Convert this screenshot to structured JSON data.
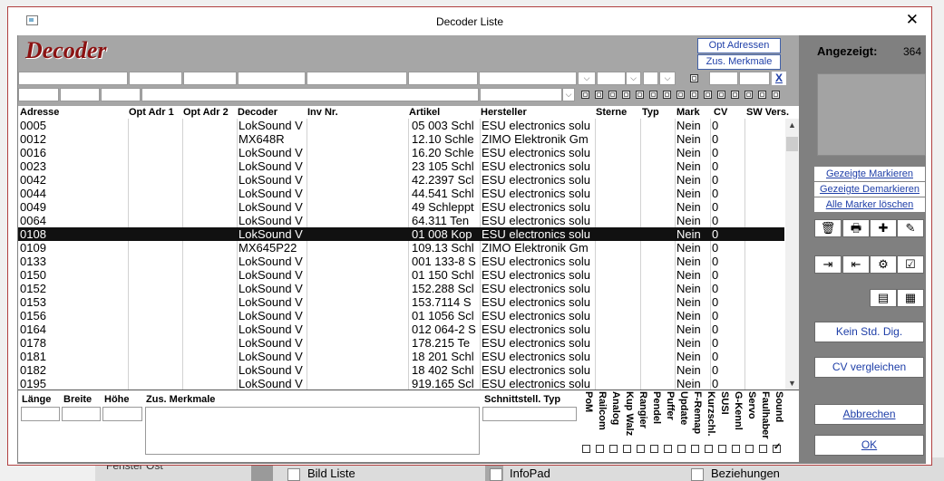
{
  "window": {
    "title": "Decoder Liste",
    "close": "✕"
  },
  "logo": "Decoder",
  "header_buttons": {
    "opt_adressen": "Opt Adressen",
    "zus_merkmale": "Zus. Merkmale"
  },
  "filter_clear": "X",
  "columns": [
    "Adresse",
    "Opt Adr 1",
    "Opt Adr 2",
    "Decoder",
    "Inv Nr.",
    "Artikel",
    "Hersteller",
    "Sterne",
    "Typ",
    "Mark",
    "CV",
    "SW Vers."
  ],
  "rows": [
    {
      "adresse": "0005",
      "decoder": "LokSound V",
      "artikel": "05 003 Schl",
      "hersteller": "ESU electronics solu",
      "mark": "Nein",
      "cv": "0"
    },
    {
      "adresse": "0012",
      "decoder": "MX648R",
      "artikel": "12.10 Schle",
      "hersteller": "ZIMO Elektronik Gm",
      "mark": "Nein",
      "cv": "0"
    },
    {
      "adresse": "0016",
      "decoder": "LokSound V",
      "artikel": "16.20 Schle",
      "hersteller": "ESU electronics solu",
      "mark": "Nein",
      "cv": "0"
    },
    {
      "adresse": "0023",
      "decoder": "LokSound V",
      "artikel": "23 105 Schl",
      "hersteller": "ESU electronics solu",
      "mark": "Nein",
      "cv": "0"
    },
    {
      "adresse": "0042",
      "decoder": "LokSound V",
      "artikel": "42.2397 Scl",
      "hersteller": "ESU electronics solu",
      "mark": "Nein",
      "cv": "0"
    },
    {
      "adresse": "0044",
      "decoder": "LokSound V",
      "artikel": "44.541 Schl",
      "hersteller": "ESU electronics solu",
      "mark": "Nein",
      "cv": "0"
    },
    {
      "adresse": "0049",
      "decoder": "LokSound V",
      "artikel": "49 Schleppt",
      "hersteller": "ESU electronics solu",
      "mark": "Nein",
      "cv": "0"
    },
    {
      "adresse": "0064",
      "decoder": "LokSound V",
      "artikel": "64.311 Ten",
      "hersteller": "ESU electronics solu",
      "mark": "Nein",
      "cv": "0"
    },
    {
      "adresse": "0108",
      "decoder": "LokSound V",
      "artikel": "01 008 Kop",
      "hersteller": "ESU electronics solu",
      "mark": "Nein",
      "cv": "0",
      "selected": true
    },
    {
      "adresse": "0109",
      "decoder": "MX645P22",
      "artikel": "109.13 Schl",
      "hersteller": "ZIMO Elektronik Gm",
      "mark": "Nein",
      "cv": "0"
    },
    {
      "adresse": "0133",
      "decoder": "LokSound V",
      "artikel": "001 133-8 S",
      "hersteller": "ESU electronics solu",
      "mark": "Nein",
      "cv": "0"
    },
    {
      "adresse": "0150",
      "decoder": "LokSound V",
      "artikel": "01 150 Schl",
      "hersteller": "ESU electronics solu",
      "mark": "Nein",
      "cv": "0"
    },
    {
      "adresse": "0152",
      "decoder": "LokSound V",
      "artikel": "152.288 Scl",
      "hersteller": "ESU electronics solu",
      "mark": "Nein",
      "cv": "0"
    },
    {
      "adresse": "0153",
      "decoder": "LokSound V",
      "artikel": "153.7114 S",
      "hersteller": "ESU electronics solu",
      "mark": "Nein",
      "cv": "0"
    },
    {
      "adresse": "0156",
      "decoder": "LokSound V",
      "artikel": "01 1056 Scl",
      "hersteller": "ESU electronics solu",
      "mark": "Nein",
      "cv": "0"
    },
    {
      "adresse": "0164",
      "decoder": "LokSound V",
      "artikel": "012 064-2 S",
      "hersteller": "ESU electronics solu",
      "mark": "Nein",
      "cv": "0"
    },
    {
      "adresse": "0178",
      "decoder": "LokSound V",
      "artikel": "178.215 Te",
      "hersteller": "ESU electronics solu",
      "mark": "Nein",
      "cv": "0"
    },
    {
      "adresse": "0181",
      "decoder": "LokSound V",
      "artikel": "18 201 Schl",
      "hersteller": "ESU electronics solu",
      "mark": "Nein",
      "cv": "0"
    },
    {
      "adresse": "0182",
      "decoder": "LokSound V",
      "artikel": "18 402 Schl",
      "hersteller": "ESU electronics solu",
      "mark": "Nein",
      "cv": "0"
    },
    {
      "adresse": "0195",
      "decoder": "LokSound V",
      "artikel": "919.165 Scl",
      "hersteller": "ESU electronics solu",
      "mark": "Nein",
      "cv": "0"
    }
  ],
  "bottom": {
    "laenge": "Länge",
    "breite": "Breite",
    "hoehe": "Höhe",
    "zus_merkmale": "Zus. Merkmale",
    "schnittstelle": "Schnittstell. Typ"
  },
  "features": [
    {
      "label": "PoM",
      "checked": false
    },
    {
      "label": "Railcom",
      "checked": false
    },
    {
      "label": "Analog",
      "checked": false
    },
    {
      "label": "Kup Walz",
      "checked": false
    },
    {
      "label": "Rangier",
      "checked": false
    },
    {
      "label": "Pendel",
      "checked": false
    },
    {
      "label": "Puffer",
      "checked": false
    },
    {
      "label": "Update",
      "checked": false
    },
    {
      "label": "F-Remap",
      "checked": false
    },
    {
      "label": "Kurzschl.",
      "checked": false
    },
    {
      "label": "SUSI",
      "checked": false
    },
    {
      "label": "G-Kennl",
      "checked": false
    },
    {
      "label": "Servo",
      "checked": false
    },
    {
      "label": "Faulhaber",
      "checked": false
    },
    {
      "label": "Sound",
      "checked": true
    }
  ],
  "right": {
    "angezeigt_label": "Angezeigt:",
    "angezeigt_value": "364",
    "gezeigte_markieren": "Gezeigte Markieren",
    "gezeigte_demarkieren": "Gezeigte Demarkieren",
    "alle_marker_loeschen": "Alle Marker löschen",
    "kein_std_dig": "Kein Std. Dig.",
    "cv_vergleichen": "CV vergleichen",
    "abbrechen": "Abbrechen",
    "ok": "OK"
  },
  "background": {
    "fenster": "Fenster Ost",
    "bild_liste": "Bild Liste",
    "infopad": "InfoPad",
    "beziehungen": "Beziehungen"
  }
}
